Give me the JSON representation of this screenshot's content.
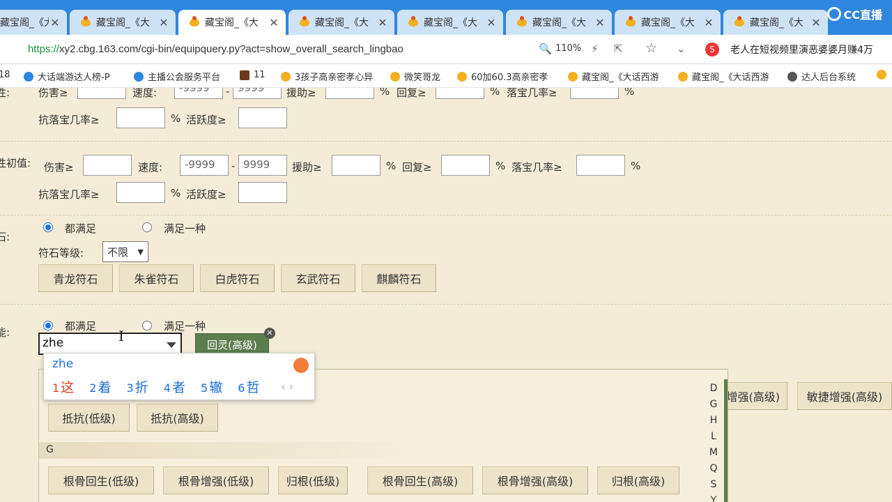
{
  "browser": {
    "tabs": [
      {
        "title": "藏宝阁_《大"
      },
      {
        "title": "藏宝阁_《大"
      },
      {
        "title": "藏宝阁_《大"
      },
      {
        "title": "藏宝阁_《大"
      },
      {
        "title": "藏宝阁_《大"
      },
      {
        "title": "藏宝阁_《大"
      },
      {
        "title": "藏宝阁_《大"
      },
      {
        "title": "藏宝阁_《大"
      }
    ],
    "first_tab_title": "藏宝阁_《大",
    "logo_text": "CC直播",
    "url_scheme": "https://",
    "url_rest": "xy2.cbg.163.com/cgi-bin/equipquery.py?act=show_overall_search_lingbao",
    "zoom": "110%",
    "news_ticker": "老人在短视频里演恶婆婆月赚4万",
    "bookmarks": [
      "18",
      "大话端游达人榜-P",
      "主播公会服务平台",
      "11",
      "3孩子高亲密孝心异",
      "微笑哥龙",
      "60加60.3高亲密孝",
      "藏宝阁_《大话西游",
      "藏宝阁_《大话西游",
      "达人后台系统"
    ]
  },
  "form": {
    "row1": {
      "label_damage": "伤害≥",
      "label_speed": "速度:",
      "speed_min": "-9999",
      "dash": "-",
      "speed_max": "9999",
      "label_assist": "援助≥",
      "pct": "%",
      "label_recover": "回复≥",
      "label_drop": "落宝几率≥",
      "label_anti_drop": "抗落宝几率≥",
      "label_active": "活跃度≥",
      "section_label": "性:"
    },
    "row2": {
      "section_label": "性初值:",
      "label_damage": "伤害≥",
      "label_speed": "速度:",
      "speed_min": "-9999",
      "dash": "-",
      "speed_max": "9999",
      "label_assist": "援助≥",
      "pct": "%",
      "label_recover": "回复≥",
      "label_drop": "落宝几率≥",
      "label_anti_drop": "抗落宝几率≥",
      "label_active": "活跃度≥"
    },
    "runes": {
      "section_label": "石:",
      "radio_all": "都满足",
      "radio_any": "满足一种",
      "level_label": "符石等级:",
      "level_value": "不限",
      "buttons": [
        "青龙符石",
        "朱雀符石",
        "白虎符石",
        "玄武符石",
        "麒麟符石"
      ]
    },
    "skills": {
      "section_label": "能:",
      "radio_all": "都满足",
      "radio_any": "满足一种",
      "input_value": "zhe",
      "selected_tag": "回灵(高级)",
      "right_buttons": [
        "增强(高级)",
        "敏捷增强(高级)"
      ],
      "group_d_buttons": [
        "抵抗(低级)",
        "抵抗(高级)"
      ],
      "group_g_head": "G",
      "group_g_buttons": [
        "根骨回生(低级)",
        "根骨增强(低级)",
        "归根(低级)",
        "根骨回生(高级)",
        "根骨增强(高级)",
        "归根(高级)"
      ],
      "letters": [
        "D",
        "G",
        "H",
        "L",
        "M",
        "Q",
        "S",
        "Y"
      ]
    }
  },
  "ime": {
    "composition": "zhe",
    "candidates": [
      {
        "n": "1",
        "c": "这"
      },
      {
        "n": "2",
        "c": "着"
      },
      {
        "n": "3",
        "c": "折"
      },
      {
        "n": "4",
        "c": "者"
      },
      {
        "n": "5",
        "c": "辙"
      },
      {
        "n": "6",
        "c": "哲"
      }
    ],
    "arrows": "‹ ›"
  }
}
